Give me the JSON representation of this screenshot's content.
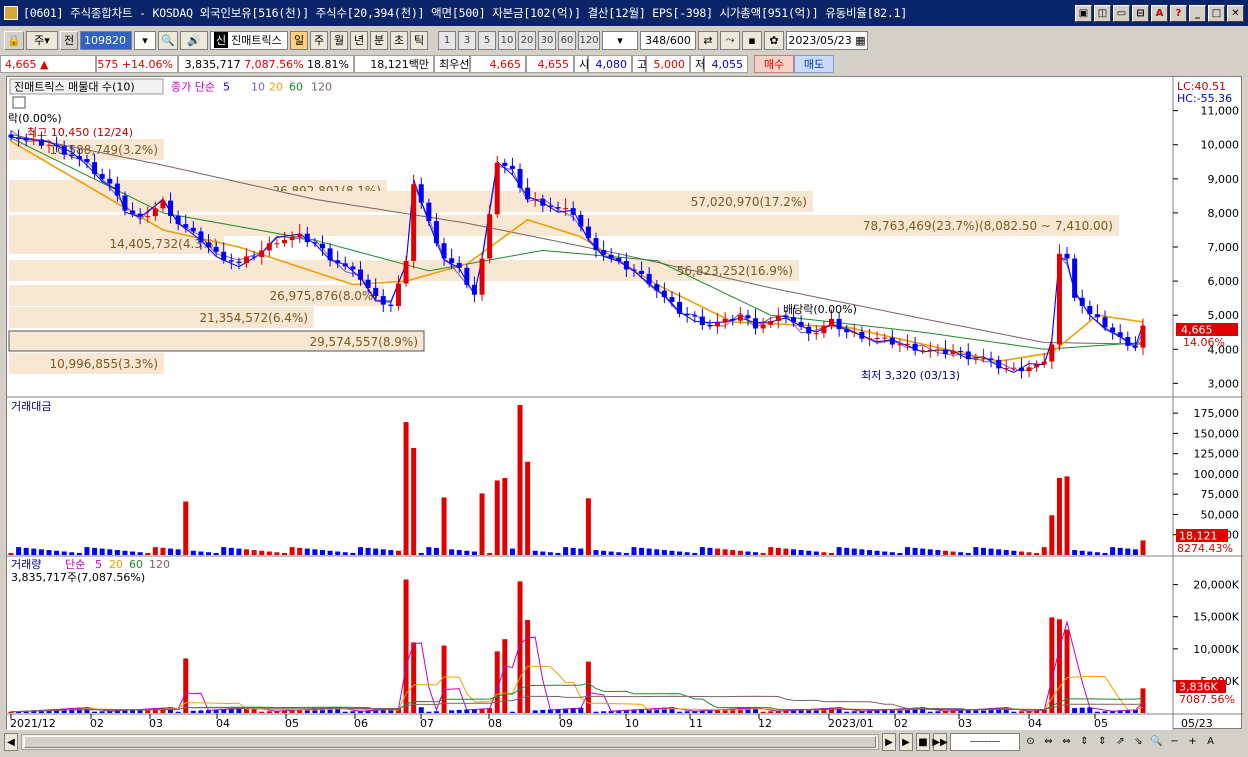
{
  "window": {
    "title": "[0601] 주식종합차트 - KOSDAQ 외국인보유[516(천)] 주식수[20,394(천)] 액면[500] 자본금[102(억)] 결산[12월] EPS[-398] 시가총액[951(억)] 유동비율[82.1]",
    "buttons": [
      "▣",
      "◫",
      "▭",
      "⊟",
      "A",
      "?",
      "_",
      "□",
      "✕"
    ]
  },
  "toolbar": {
    "market": "주",
    "prev_label": "전",
    "code": "109820",
    "chart_title": "진매트릭스",
    "periods": [
      "일",
      "주",
      "월",
      "년",
      "분",
      "초",
      "틱"
    ],
    "active_period": "일",
    "intervals": [
      "1",
      "3",
      "5",
      "10",
      "20",
      "30",
      "60",
      "120"
    ],
    "count": "348",
    "count_total": "/600",
    "date": "2023/05/23"
  },
  "quote": {
    "price": "4,665",
    "arrow": "▲",
    "change": "575",
    "change_pct": "+14.06%",
    "volume": "3,835,717",
    "vol_ratio": "7,087.56%",
    "turnover": "18.81%",
    "value_label": "18,121백만",
    "bid_label": "최우선",
    "ask": "4,665",
    "bid": "4,655",
    "open_label": "시",
    "open": "4,080",
    "high_label": "고",
    "high": "5,000",
    "low_label": "저",
    "low": "4,055",
    "buy": "매수",
    "sell": "매도"
  },
  "panes": {
    "price": {
      "title": "진매트릭스 매물대 수(10)",
      "ma_label": "종가 단순",
      "ma_periods": [
        "5",
        "10",
        "20",
        "60",
        "120"
      ],
      "ma_colors": [
        "#0000ff",
        "#7f5fbf",
        "#f0a000",
        "#1a8c2a",
        "#7b6464"
      ],
      "lc": "LC:40.51",
      "hc": "HC:-55.36",
      "ex_right": "락(0.00%)",
      "high_note": "최고 10,450 (12/24)",
      "low_note": "최저 3,320 (03/13)",
      "div_note": "배당락(0.00%)",
      "cur_price": "4,665",
      "cur_pct": "14.06%"
    },
    "amount": {
      "title": "거래대금",
      "cur": "18,121",
      "cur_pct": "8274.43%"
    },
    "volume": {
      "title": "거래량",
      "ma_label": "단순",
      "ma_periods": [
        "5",
        "20",
        "60",
        "120"
      ],
      "cur_text": "3,835,717주(7,087.56%)",
      "cur": "3,836K",
      "cur_pct": "7087.56%"
    }
  },
  "volume_profile": [
    {
      "label": "10,588,749(3.2%)"
    },
    {
      "label": "26,892,801(8.1%)"
    },
    {
      "label": "57,020,970(17.2%)"
    },
    {
      "label": "78,763,469(23.7%)(8,082.50 ~ 7,410.00)"
    },
    {
      "label": "14,405,732(4.3%)"
    },
    {
      "label": "56,823,252(16.9%)"
    },
    {
      "label": "26,975,876(8.0%)"
    },
    {
      "label": "21,354,572(6.4%)"
    },
    {
      "label": "29,574,557(8.9%)"
    },
    {
      "label": "10,996,855(3.3%)"
    }
  ],
  "axes": {
    "price_ticks": [
      "11,000",
      "10,000",
      "9,000",
      "8,000",
      "7,000",
      "6,000",
      "5,000",
      "4,000",
      "3,000"
    ],
    "amount_ticks": [
      "175,000",
      "150,000",
      "125,000",
      "100,000",
      "75,000",
      "50,000",
      "25,000"
    ],
    "volume_ticks": [
      "20,000K",
      "15,000K",
      "10,000K",
      "5,000K"
    ],
    "months": [
      "2021/12",
      "02",
      "03",
      "04",
      "05",
      "06",
      "07",
      "08",
      "09",
      "10",
      "11",
      "12",
      "2023/01",
      "02",
      "03",
      "04",
      "05"
    ],
    "right_date": "05/23"
  },
  "chart_data": {
    "type": "candlestick",
    "x_start": "2021-12",
    "x_end": "2023-05-23",
    "price_ylim": [
      2800,
      11200
    ],
    "close_path": [
      [
        0,
        10300
      ],
      [
        2,
        10100
      ],
      [
        5,
        10000
      ],
      [
        8,
        9700
      ],
      [
        10,
        9400
      ],
      [
        12,
        9000
      ],
      [
        14,
        8600
      ],
      [
        15,
        8100
      ],
      [
        17,
        7800
      ],
      [
        20,
        8300
      ],
      [
        22,
        7700
      ],
      [
        25,
        7200
      ],
      [
        27,
        6800
      ],
      [
        30,
        6500
      ],
      [
        33,
        6900
      ],
      [
        35,
        7200
      ],
      [
        38,
        7300
      ],
      [
        40,
        7100
      ],
      [
        42,
        6700
      ],
      [
        44,
        6400
      ],
      [
        46,
        6100
      ],
      [
        48,
        5500
      ],
      [
        50,
        5300
      ],
      [
        52,
        6500
      ],
      [
        53,
        8900
      ],
      [
        55,
        7700
      ],
      [
        57,
        6700
      ],
      [
        59,
        6300
      ],
      [
        61,
        5600
      ],
      [
        62,
        6600
      ],
      [
        64,
        9500
      ],
      [
        66,
        9200
      ],
      [
        68,
        8400
      ],
      [
        70,
        8300
      ],
      [
        72,
        8100
      ],
      [
        74,
        8000
      ],
      [
        76,
        7200
      ],
      [
        78,
        6800
      ],
      [
        80,
        6500
      ],
      [
        82,
        6300
      ],
      [
        84,
        6000
      ],
      [
        86,
        5500
      ],
      [
        88,
        5100
      ],
      [
        90,
        4900
      ],
      [
        92,
        4700
      ],
      [
        94,
        4800
      ],
      [
        96,
        5000
      ],
      [
        98,
        4700
      ],
      [
        100,
        4800
      ],
      [
        102,
        5000
      ],
      [
        104,
        4600
      ],
      [
        106,
        4500
      ],
      [
        108,
        4800
      ],
      [
        110,
        4500
      ],
      [
        112,
        4400
      ],
      [
        114,
        4300
      ],
      [
        116,
        4200
      ],
      [
        118,
        4100
      ],
      [
        120,
        4000
      ],
      [
        122,
        3900
      ],
      [
        124,
        3950
      ],
      [
        126,
        3800
      ],
      [
        128,
        3700
      ],
      [
        130,
        3500
      ],
      [
        132,
        3400
      ],
      [
        134,
        3500
      ],
      [
        136,
        3550
      ],
      [
        137,
        4200
      ],
      [
        138,
        6800
      ],
      [
        139,
        6600
      ],
      [
        140,
        5600
      ],
      [
        142,
        5000
      ],
      [
        144,
        4700
      ],
      [
        146,
        4300
      ],
      [
        148,
        4080
      ],
      [
        149,
        4665
      ]
    ],
    "ma120_path": [
      [
        0,
        10300
      ],
      [
        20,
        9400
      ],
      [
        40,
        8400
      ],
      [
        60,
        7700
      ],
      [
        80,
        6800
      ],
      [
        100,
        5800
      ],
      [
        120,
        4900
      ],
      [
        136,
        4200
      ],
      [
        149,
        4150
      ]
    ],
    "ma60_path": [
      [
        0,
        10200
      ],
      [
        20,
        8000
      ],
      [
        40,
        7200
      ],
      [
        55,
        6300
      ],
      [
        70,
        6900
      ],
      [
        85,
        6600
      ],
      [
        100,
        5000
      ],
      [
        120,
        4500
      ],
      [
        136,
        4000
      ],
      [
        149,
        4200
      ]
    ],
    "ma20_path": [
      [
        0,
        10100
      ],
      [
        20,
        7500
      ],
      [
        30,
        7000
      ],
      [
        45,
        5900
      ],
      [
        52,
        6000
      ],
      [
        60,
        6500
      ],
      [
        68,
        7800
      ],
      [
        75,
        7300
      ],
      [
        85,
        5900
      ],
      [
        95,
        4800
      ],
      [
        110,
        4650
      ],
      [
        130,
        3650
      ],
      [
        137,
        3900
      ],
      [
        143,
        5000
      ],
      [
        149,
        4800
      ]
    ],
    "amount_spikes": [
      [
        23,
        66
      ],
      [
        52,
        164
      ],
      [
        53,
        132
      ],
      [
        57,
        71
      ],
      [
        62,
        76
      ],
      [
        64,
        92
      ],
      [
        65,
        95
      ],
      [
        67,
        185
      ],
      [
        68,
        115
      ],
      [
        76,
        70
      ],
      [
        137,
        49
      ],
      [
        138,
        95
      ],
      [
        139,
        97
      ],
      [
        149,
        18
      ]
    ],
    "volume_spikes_k": [
      [
        23,
        8500
      ],
      [
        52,
        20800
      ],
      [
        53,
        11000
      ],
      [
        57,
        10500
      ],
      [
        64,
        9600
      ],
      [
        65,
        11500
      ],
      [
        67,
        20500
      ],
      [
        68,
        14500
      ],
      [
        76,
        8000
      ],
      [
        137,
        14900
      ],
      [
        138,
        14600
      ],
      [
        139,
        13000
      ],
      [
        149,
        3836
      ]
    ]
  }
}
